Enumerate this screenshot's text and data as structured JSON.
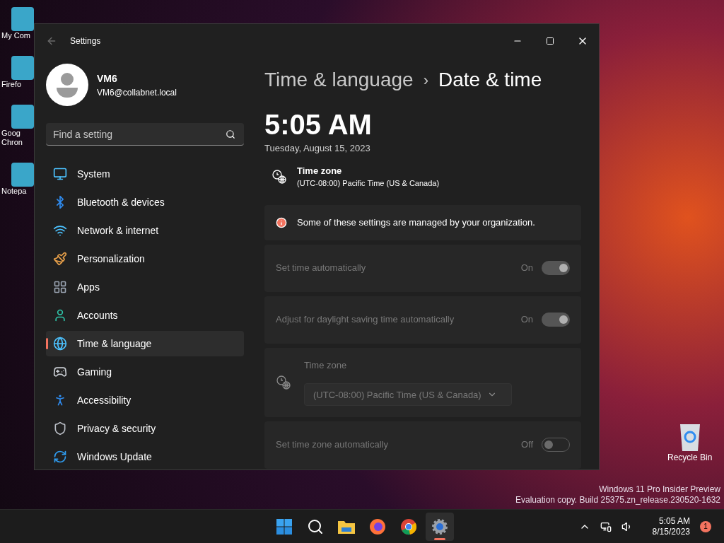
{
  "desktop": {
    "icons": [
      {
        "label": "My Com"
      },
      {
        "label": "Firefo"
      },
      {
        "label": "Goog Chron"
      },
      {
        "label": "Notepa"
      }
    ],
    "recycle_bin": {
      "label": "Recycle Bin"
    },
    "watermark": [
      "Windows 11 Pro Insider Preview",
      "Evaluation copy. Build 25375.zn_release.230520-1632"
    ]
  },
  "window": {
    "title": "Settings",
    "user": {
      "name": "VM6",
      "email": "VM6@collabnet.local"
    },
    "search": {
      "placeholder": "Find a setting"
    },
    "nav": [
      {
        "label": "System",
        "selected": false
      },
      {
        "label": "Bluetooth & devices",
        "selected": false
      },
      {
        "label": "Network & internet",
        "selected": false
      },
      {
        "label": "Personalization",
        "selected": false
      },
      {
        "label": "Apps",
        "selected": false
      },
      {
        "label": "Accounts",
        "selected": false
      },
      {
        "label": "Time & language",
        "selected": true
      },
      {
        "label": "Gaming",
        "selected": false
      },
      {
        "label": "Accessibility",
        "selected": false
      },
      {
        "label": "Privacy & security",
        "selected": false
      },
      {
        "label": "Windows Update",
        "selected": false
      }
    ],
    "breadcrumb": {
      "parent": "Time & language",
      "separator": "›",
      "current": "Date & time"
    },
    "time": "5:05 AM",
    "date": "Tuesday, August 15, 2023",
    "timezone_summary": {
      "label": "Time zone",
      "value": "(UTC-08:00) Pacific Time (US & Canada)"
    },
    "notice": "Some of these settings are managed by your organization.",
    "settings": [
      {
        "kind": "toggle",
        "label": "Set time automatically",
        "state_text": "On",
        "on": true,
        "disabled": true
      },
      {
        "kind": "toggle",
        "label": "Adjust for daylight saving time automatically",
        "state_text": "On",
        "on": true,
        "disabled": true
      },
      {
        "kind": "dropdown",
        "label": "Time zone",
        "value": "(UTC-08:00) Pacific Time (US & Canada)",
        "disabled": true
      },
      {
        "kind": "toggle",
        "label": "Set time zone automatically",
        "state_text": "Off",
        "on": false,
        "disabled": true
      }
    ]
  },
  "taskbar": {
    "apps": [
      {
        "selected": false
      },
      {
        "selected": false
      },
      {
        "selected": false
      },
      {
        "selected": false
      },
      {
        "selected": false
      },
      {
        "selected": true
      }
    ],
    "clock": {
      "time": "5:05 AM",
      "date": "8/15/2023"
    },
    "notification_count": "1"
  }
}
